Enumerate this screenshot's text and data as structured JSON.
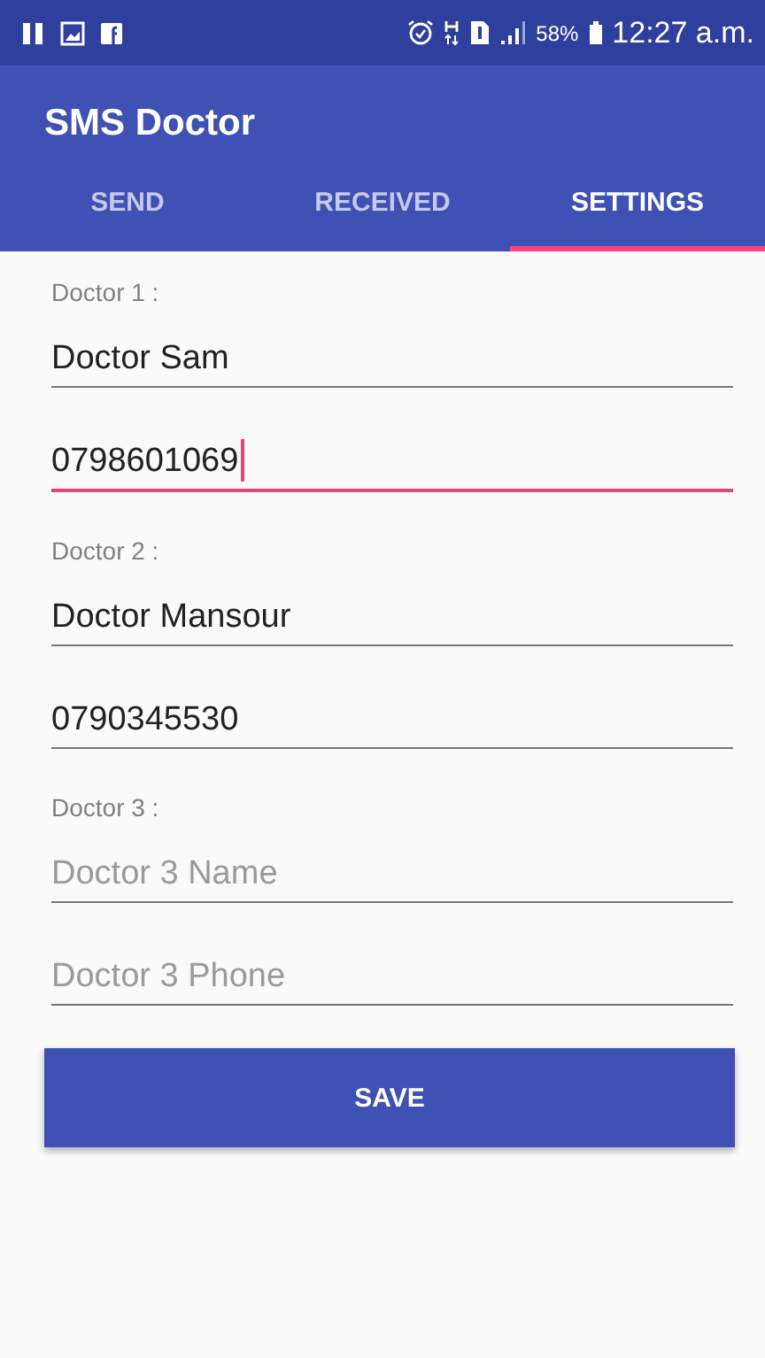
{
  "status_bar": {
    "battery": "58%",
    "time": "12:27 a.m."
  },
  "app_bar": {
    "title": "SMS Doctor"
  },
  "tabs": [
    {
      "label": "SEND",
      "selected": false
    },
    {
      "label": "RECEIVED",
      "selected": false
    },
    {
      "label": "SETTINGS",
      "selected": true
    }
  ],
  "doctors": [
    {
      "label": "Doctor 1 :",
      "fields": [
        {
          "value": "Doctor Sam",
          "focused": false
        },
        {
          "value": "0798601069",
          "focused": true
        }
      ]
    },
    {
      "label": "Doctor 2 :",
      "fields": [
        {
          "value": "Doctor Mansour",
          "focused": false
        },
        {
          "value": "0790345530",
          "focused": false
        }
      ]
    },
    {
      "label": "Doctor 3 :",
      "fields": [
        {
          "placeholder": "Doctor 3 Name",
          "focused": false
        },
        {
          "placeholder": "Doctor 3 Phone",
          "focused": false
        }
      ]
    }
  ],
  "save_button": "SAVE"
}
